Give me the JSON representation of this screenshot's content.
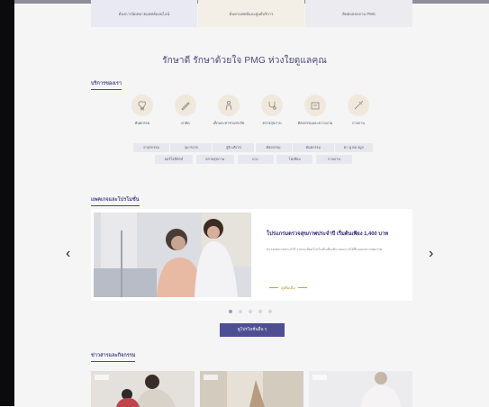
{
  "top_cards": [
    {
      "text": "ต้องการนัดหมายแพทย์ออนไลน์"
    },
    {
      "text": "ค้นหาแพทย์และศูนย์บริการ"
    },
    {
      "text": "ติดต่อสอบถาม PMG"
    }
  ],
  "headline": "รักษาดี รักษาด้วยใจ PMG ห่วงใยดูแลคุณ",
  "services_section": {
    "title": "บริการของเรา",
    "items": [
      {
        "label": "ทันตกรรม",
        "icon": "tooth-icon"
      },
      {
        "label": "ผ่าตัด",
        "icon": "scalpel-icon"
      },
      {
        "label": "เด็กและทารกแรกเกิด",
        "icon": "child-icon"
      },
      {
        "label": "ตรวจสุขภาพ",
        "icon": "stethoscope-icon"
      },
      {
        "label": "ศัลยกรรมและความงาม",
        "icon": "beauty-icon"
      },
      {
        "label": "กายภาพ",
        "icon": "injection-icon"
      }
    ],
    "chips_row1": [
      "อายุรกรรม",
      "กุมารเวช",
      "สูติ-นรีเวช",
      "ศัลยกรรม",
      "ทันตกรรม",
      "ตา หู คอ จมูก"
    ],
    "chips_row2": [
      "ออร์โธปิดิกส์",
      "ตรวจสุขภาพ",
      "ICU",
      "ไตเทียม",
      "กายภาพ"
    ]
  },
  "promo_section": {
    "title": "แพคเกจและโปรโมชั่น",
    "promo_title": "โปรแกรมตรวจสุขภาพประจำปี เริ่มต้นเพียง 1,400 บาท",
    "promo_desc": "ตรวจสุขภาพประจำปี รายละเอียดโปรโมชั่นเพิ่มเติม สอบถามได้ที่แผนกตรวจสุขภาพ",
    "read_more": "ดูเพิ่มเติม",
    "dots_count": 5,
    "active_dot": 1
  },
  "cta_label": "ดูโปรโมชั่นอื่น ๆ",
  "news_section": {
    "title": "ข่าวสารและกิจกรรม",
    "cards": [
      "ข่าวสาร",
      "กิจกรรม",
      "ข่าวสาร"
    ]
  },
  "nav": {
    "prev": "‹",
    "next": "›"
  }
}
